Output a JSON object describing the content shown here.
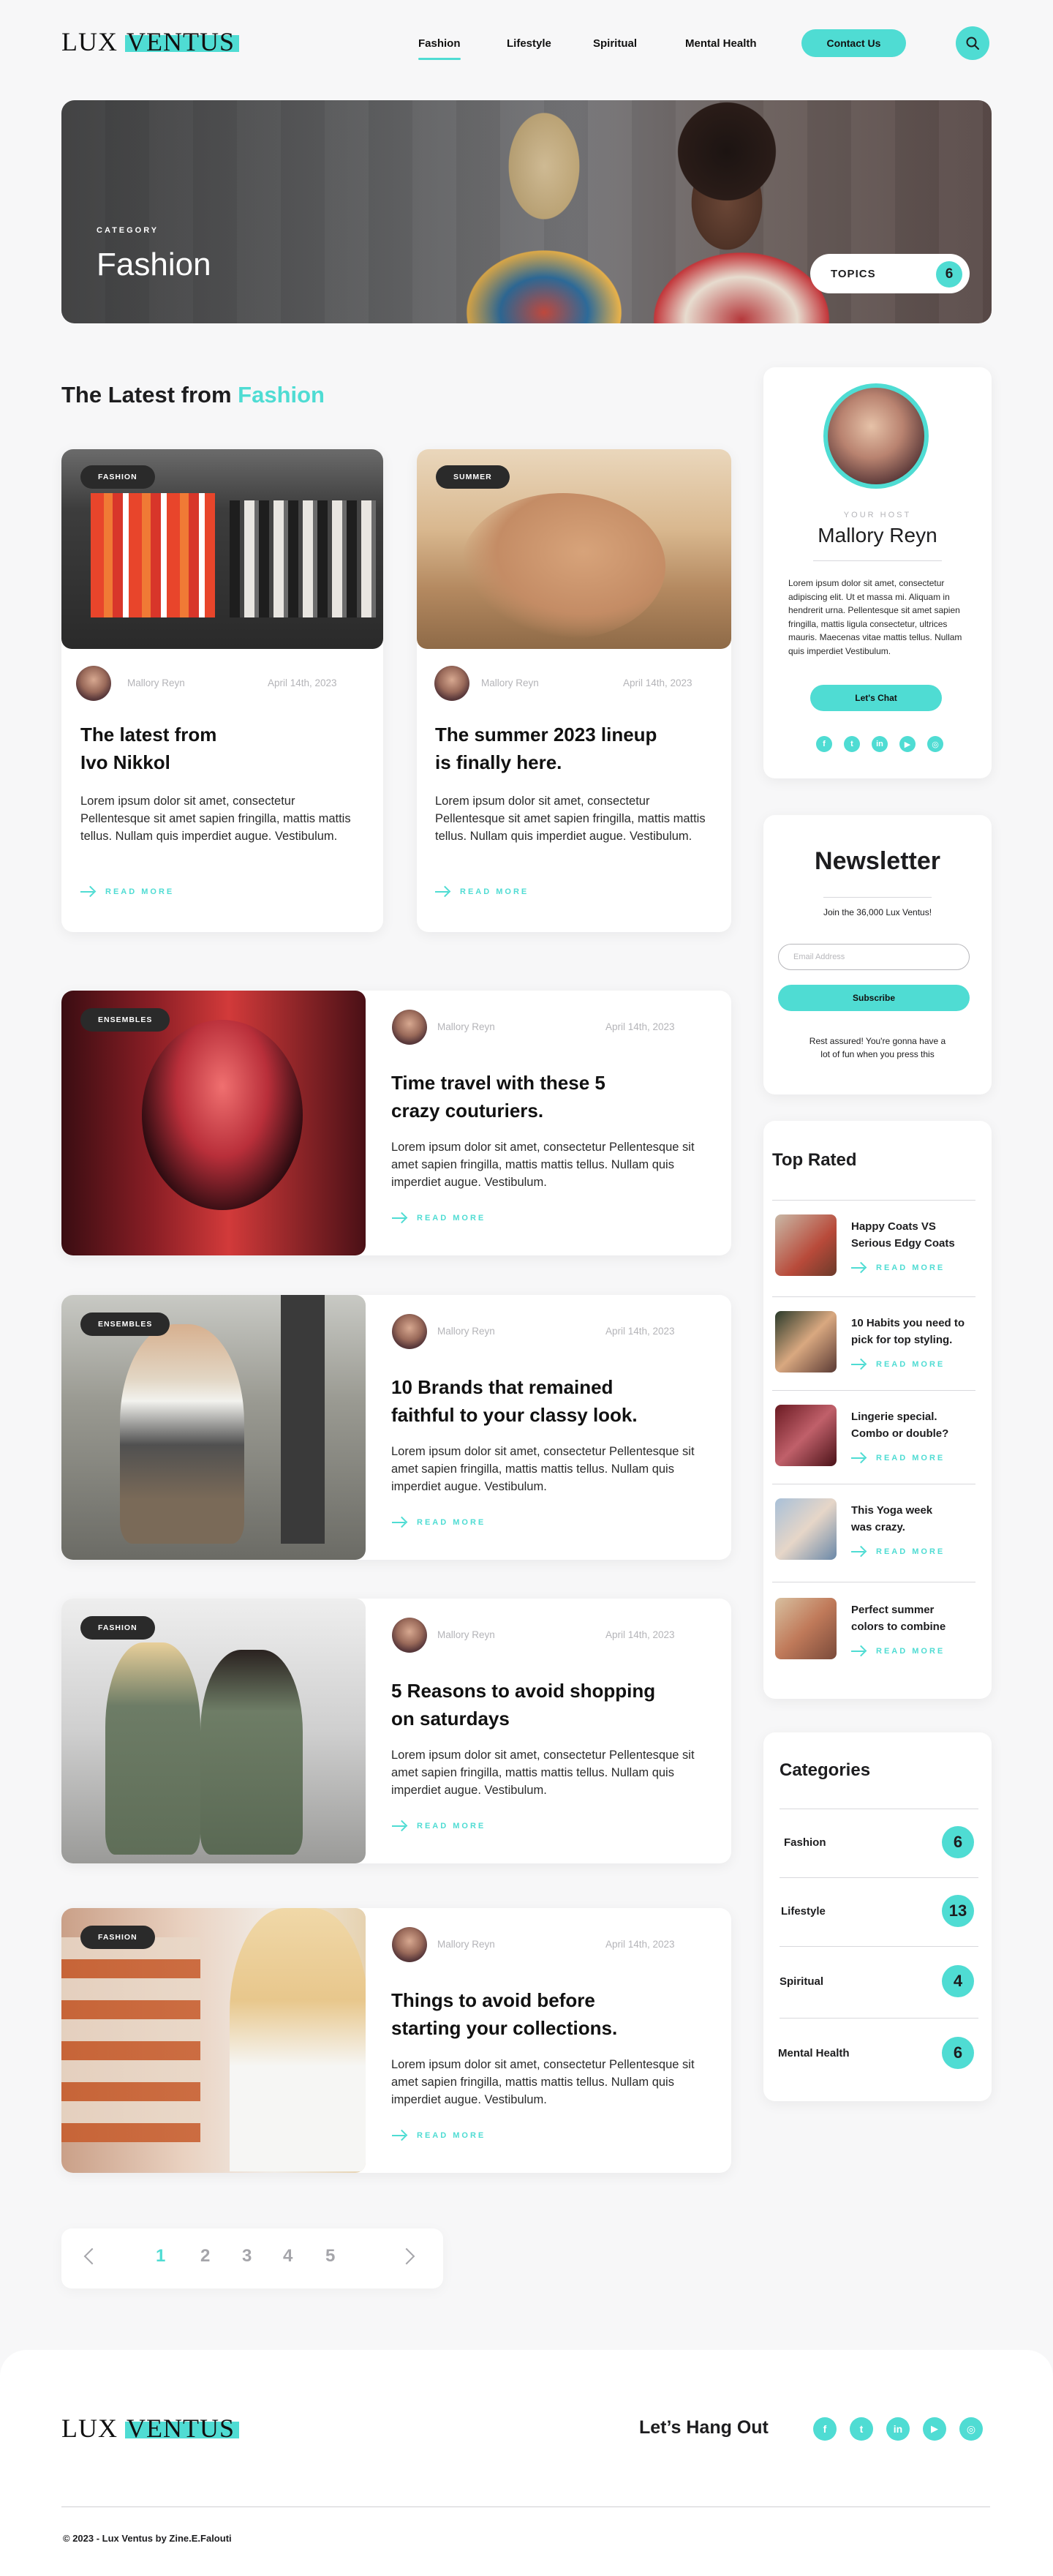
{
  "brand": {
    "logo_part1": "LUX ",
    "logo_part2": "VENTUS"
  },
  "nav": {
    "items": [
      "Fashion",
      "Lifestyle",
      "Spiritual",
      "Mental Health"
    ],
    "contact_label": "Contact Us",
    "search_icon": "search-icon"
  },
  "hero": {
    "category_label": "CATEGORY",
    "title": "Fashion",
    "topics_label": "TOPICS",
    "topics_count": "6"
  },
  "latest": {
    "title_prefix": "The Latest from ",
    "title_highlight": "Fashion"
  },
  "read_more": "READ MORE",
  "posts": [
    {
      "tag": "FASHION",
      "author": "Mallory Reyn",
      "date": "April 14th, 2023",
      "title_line1": "The latest from",
      "title_line2": "Ivo Nikkol",
      "text": "Lorem ipsum dolor sit amet, consectetur Pellentesque sit amet sapien fringilla, mattis mattis tellus. Nullam quis imperdiet augue. Vestibulum."
    },
    {
      "tag": "SUMMER",
      "author": "Mallory Reyn",
      "date": "April 14th, 2023",
      "title_line1": "The summer 2023 lineup",
      "title_line2": "is finally here.",
      "text": "Lorem ipsum dolor sit amet, consectetur Pellentesque sit amet sapien fringilla, mattis mattis tellus. Nullam quis imperdiet augue. Vestibulum."
    },
    {
      "tag": "ENSEMBLES",
      "author": "Mallory Reyn",
      "date": "April 14th, 2023",
      "title_line1": "Time travel with these 5",
      "title_line2": "crazy couturiers.",
      "text": "Lorem ipsum dolor sit amet, consectetur Pellentesque sit amet sapien fringilla, mattis mattis tellus. Nullam quis imperdiet augue. Vestibulum."
    },
    {
      "tag": "ENSEMBLES",
      "author": "Mallory Reyn",
      "date": "April 14th, 2023",
      "title_line1": "10 Brands that remained",
      "title_line2": "faithful to your classy look.",
      "text": "Lorem ipsum dolor sit amet, consectetur Pellentesque sit amet sapien fringilla, mattis mattis tellus. Nullam quis imperdiet augue. Vestibulum."
    },
    {
      "tag": "FASHION",
      "author": "Mallory Reyn",
      "date": "April 14th, 2023",
      "title_line1": "5 Reasons to avoid shopping",
      "title_line2": "on saturdays",
      "text": "Lorem ipsum dolor sit amet, consectetur Pellentesque sit amet sapien fringilla, mattis mattis tellus. Nullam quis imperdiet augue. Vestibulum."
    },
    {
      "tag": "FASHION",
      "author": "Mallory Reyn",
      "date": "April 14th, 2023",
      "title_line1": "Things to avoid before",
      "title_line2": "starting your collections.",
      "text": "Lorem ipsum dolor sit amet, consectetur Pellentesque sit amet sapien fringilla, mattis mattis tellus. Nullam quis imperdiet augue. Vestibulum."
    }
  ],
  "host": {
    "label": "YOUR HOST",
    "name": "Mallory Reyn",
    "bio": "Lorem ipsum dolor sit amet, consectetur adipiscing elit. Ut et massa mi. Aliquam in hendrerit urna. Pellentesque sit amet sapien fringilla, mattis ligula consectetur, ultrices mauris. Maecenas vitae mattis tellus. Nullam quis imperdiet Vestibulum.",
    "chat_label": "Let's Chat",
    "socials": [
      "facebook-icon",
      "twitter-icon",
      "linkedin-icon",
      "youtube-icon",
      "instagram-icon"
    ]
  },
  "newsletter": {
    "title": "Newsletter",
    "subtitle": "Join the 36,000 Lux Ventus!",
    "email_placeholder": "Email Address",
    "subscribe_label": "Subscribe",
    "note": "Rest assured! You're gonna have a lot of fun when you press this"
  },
  "top_rated": {
    "title": "Top Rated",
    "items": [
      {
        "line1": "Happy Coats VS",
        "line2": "Serious Edgy Coats"
      },
      {
        "line1": "10 Habits you need to",
        "line2": "pick for top styling."
      },
      {
        "line1": "Lingerie special.",
        "line2": "Combo or double?"
      },
      {
        "line1": "This Yoga week",
        "line2": "was crazy."
      },
      {
        "line1": "Perfect summer",
        "line2": "colors to combine"
      }
    ]
  },
  "categories": {
    "title": "Categories",
    "items": [
      {
        "name": "Fashion",
        "count": "6"
      },
      {
        "name": "Lifestyle",
        "count": "13"
      },
      {
        "name": "Spiritual",
        "count": "4"
      },
      {
        "name": "Mental Health",
        "count": "6"
      }
    ]
  },
  "pagination": {
    "pages": [
      "1",
      "2",
      "3",
      "4",
      "5"
    ],
    "current": "1"
  },
  "footer": {
    "hangout": "Let’s Hang Out",
    "copyright": "© 2023 - Lux Ventus by Zine.E.Falouti"
  },
  "colors": {
    "accent": "#4fdcd3",
    "dark": "#1d1d1f",
    "tag_bg": "#2a2a2a"
  }
}
